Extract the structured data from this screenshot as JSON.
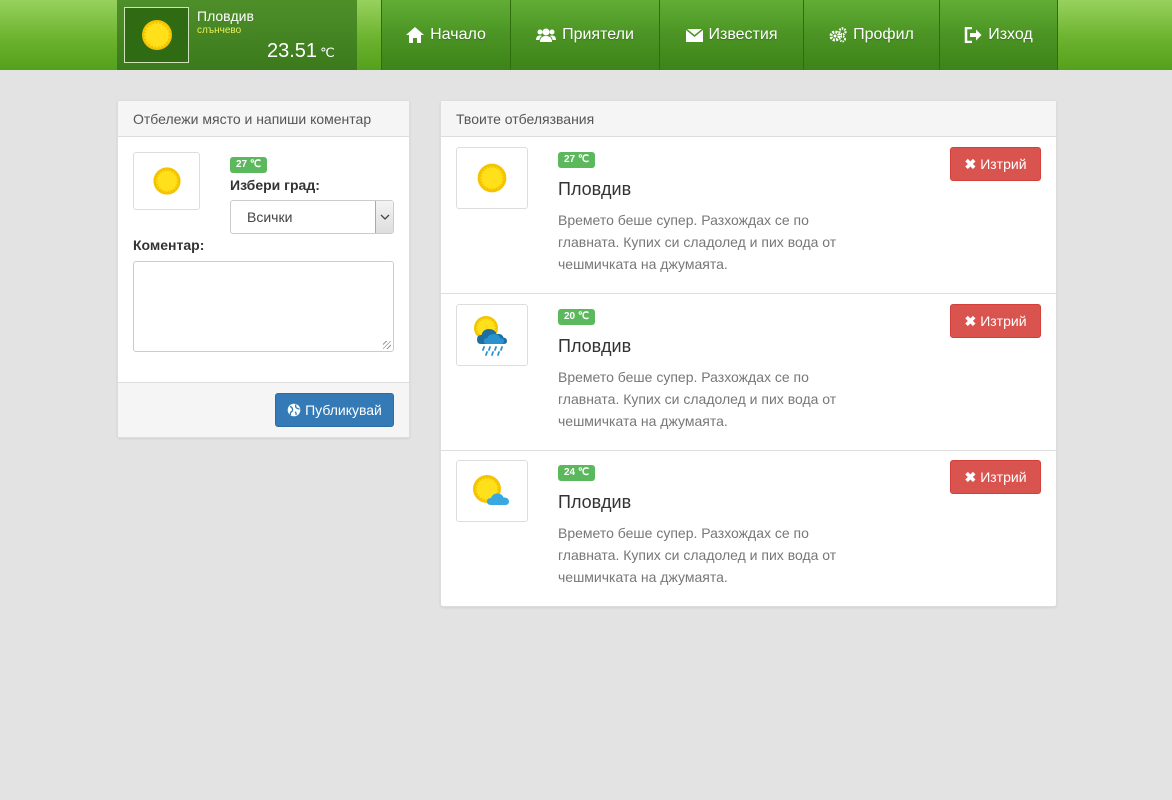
{
  "weather": {
    "city": "Пловдив",
    "condition": "слънчево",
    "temperature": "23.51",
    "unit": "℃",
    "icon": "sun-icon"
  },
  "nav": {
    "items": [
      {
        "label": "Начало",
        "icon": "home-icon"
      },
      {
        "label": "Приятели",
        "icon": "users-icon"
      },
      {
        "label": "Известия",
        "icon": "envelope-icon"
      },
      {
        "label": "Профил",
        "icon": "gears-icon"
      },
      {
        "label": "Изход",
        "icon": "logout-icon"
      }
    ]
  },
  "compose": {
    "heading": "Отбележи място и напиши коментар",
    "temp_badge": "27 ℃",
    "city_label": "Избери град:",
    "city_selected": "Всички",
    "comment_label": "Коментар:",
    "comment_value": "",
    "publish_label": "Публикувай"
  },
  "feed": {
    "heading": "Твоите отбелязвания",
    "delete_label": "Изтрий",
    "posts": [
      {
        "temp_badge": "27 ℃",
        "city": "Пловдив",
        "text": "Времето беше супер. Разхождах се по главната. Купих си сладолед и пих вода от чешмичката на джумаята.",
        "icon": "sun-icon"
      },
      {
        "temp_badge": "20 ℃",
        "city": "Пловдив",
        "text": "Времето беше супер. Разхождах се по главната. Купих си сладолед и пих вода от чешмичката на джумаята.",
        "icon": "rain-cloud-sun-icon"
      },
      {
        "temp_badge": "24 ℃",
        "city": "Пловдив",
        "text": "Времето беше супер. Разхождах се по главната. Купих си сладолед и пих вода от чешмичката на джумаята.",
        "icon": "partly-cloudy-icon"
      }
    ]
  },
  "colors": {
    "accent_green": "#5cb85c",
    "primary_blue": "#337ab7",
    "danger_red": "#d9534f",
    "sun_yellow": "#f5d000"
  }
}
